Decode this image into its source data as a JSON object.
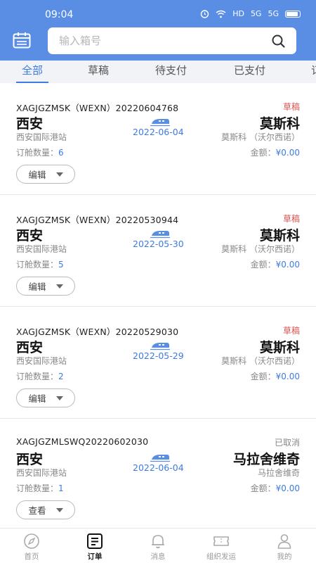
{
  "status_bar": {
    "time": "09:04",
    "network": "HD",
    "signal1": "5G",
    "signal2": "5G"
  },
  "header": {
    "search_placeholder": "输入箱号"
  },
  "tabs": [
    {
      "label": "全部",
      "active": true
    },
    {
      "label": "草稿",
      "active": false
    },
    {
      "label": "待支付",
      "active": false
    },
    {
      "label": "已支付",
      "active": false
    },
    {
      "label": "订",
      "active": false
    }
  ],
  "orders": [
    {
      "code": "XAGJGZMSK（WEXN）20220604768",
      "status": "草稿",
      "status_color": "#d9534f",
      "from": "西安",
      "from_station": "西安国际港站",
      "date": "2022-06-04",
      "to": "莫斯科",
      "to_station": "莫斯科 （沃尔西诺）",
      "qty_label": "订舱数量：",
      "qty": "6",
      "amount_label": "金额：",
      "amount": "¥0.00",
      "action": "编辑"
    },
    {
      "code": "XAGJGZMSK（WEXN）20220530944",
      "status": "草稿",
      "status_color": "#d9534f",
      "from": "西安",
      "from_station": "西安国际港站",
      "date": "2022-05-30",
      "to": "莫斯科",
      "to_station": "莫斯科 （沃尔西诺）",
      "qty_label": "订舱数量：",
      "qty": "5",
      "amount_label": "金额：",
      "amount": "¥0.00",
      "action": "编辑"
    },
    {
      "code": "XAGJGZMSK（WEXN）20220529030",
      "status": "草稿",
      "status_color": "#d9534f",
      "from": "西安",
      "from_station": "西安国际港站",
      "date": "2022-05-29",
      "to": "莫斯科",
      "to_station": "莫斯科 （沃尔西诺）",
      "qty_label": "订舱数量：",
      "qty": "2",
      "amount_label": "金额：",
      "amount": "¥0.00",
      "action": "编辑"
    },
    {
      "code": "XAGJGZMLSWQ20220602030",
      "status": "已取消",
      "status_color": "#888888",
      "from": "西安",
      "from_station": "西安国际港站",
      "date": "2022-06-04",
      "to": "马拉舍维奇",
      "to_station": "马拉舍维奇",
      "qty_label": "订舱数量：",
      "qty": "1",
      "amount_label": "金额：",
      "amount": "¥0.00",
      "action": "查看"
    }
  ],
  "tabbar": [
    {
      "label": "首页",
      "icon": "compass-icon",
      "active": false
    },
    {
      "label": "订单",
      "icon": "order-list-icon",
      "active": true
    },
    {
      "label": "消息",
      "icon": "bell-icon",
      "active": false
    },
    {
      "label": "组织发运",
      "icon": "ticket-icon",
      "active": false
    },
    {
      "label": "我的",
      "icon": "person-icon",
      "active": false
    }
  ],
  "colors": {
    "header_bg": "#5a8ee5",
    "accent": "#3e7be0",
    "draft": "#d9534f",
    "cancelled": "#888888"
  }
}
